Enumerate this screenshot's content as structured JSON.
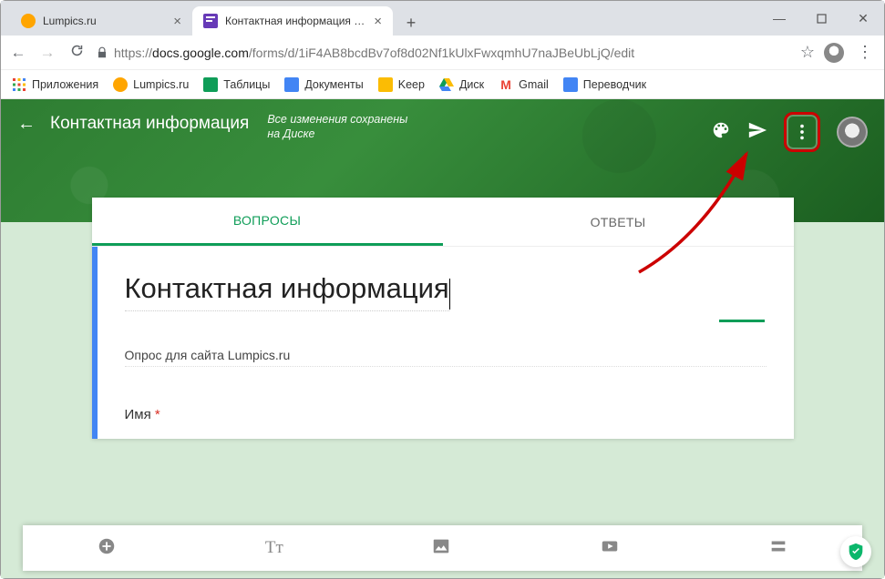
{
  "window": {
    "minimize": "—",
    "maximize": "▢",
    "close": "✕"
  },
  "tabs": [
    {
      "label": "Lumpics.ru",
      "active": false
    },
    {
      "label": "Контактная информация - Goo…",
      "active": true
    }
  ],
  "newtab_label": "+",
  "nav": {
    "back": "←",
    "forward": "→",
    "reload": "↻"
  },
  "url": {
    "scheme": "https://",
    "host": "docs.google.com",
    "path": "/forms/d/1iF4AB8bcdBv7of8d02Nf1kUlxFwxqmhU7naJBeUbLjQ/edit"
  },
  "star": "☆",
  "chrome_menu": "⋮",
  "bookmarks": {
    "apps": "Приложения",
    "items": [
      {
        "label": "Lumpics.ru",
        "color": "#ffa500"
      },
      {
        "label": "Таблицы",
        "color": "#0f9d58"
      },
      {
        "label": "Документы",
        "color": "#4285f4"
      },
      {
        "label": "Keep",
        "color": "#fbbc04"
      },
      {
        "label": "Диск",
        "color": "#0f9d58"
      },
      {
        "label": "Gmail",
        "color": "#ea4335"
      },
      {
        "label": "Переводчик",
        "color": "#4285f4"
      }
    ]
  },
  "forms_header": {
    "back": "←",
    "title": "Контактная информация",
    "status_line1": "Все изменения сохранены",
    "status_line2": "на Диске",
    "more": "⋮"
  },
  "form_tabs": {
    "questions": "ВОПРОСЫ",
    "responses": "ОТВЕТЫ"
  },
  "form": {
    "title": "Контактная информация",
    "description": "Опрос для сайта Lumpics.ru",
    "q1_label": "Имя",
    "required_mark": "*"
  },
  "toolbar_bottom": {
    "add": "add",
    "title": "Tт",
    "image": "image",
    "video": "video",
    "section": "section"
  }
}
